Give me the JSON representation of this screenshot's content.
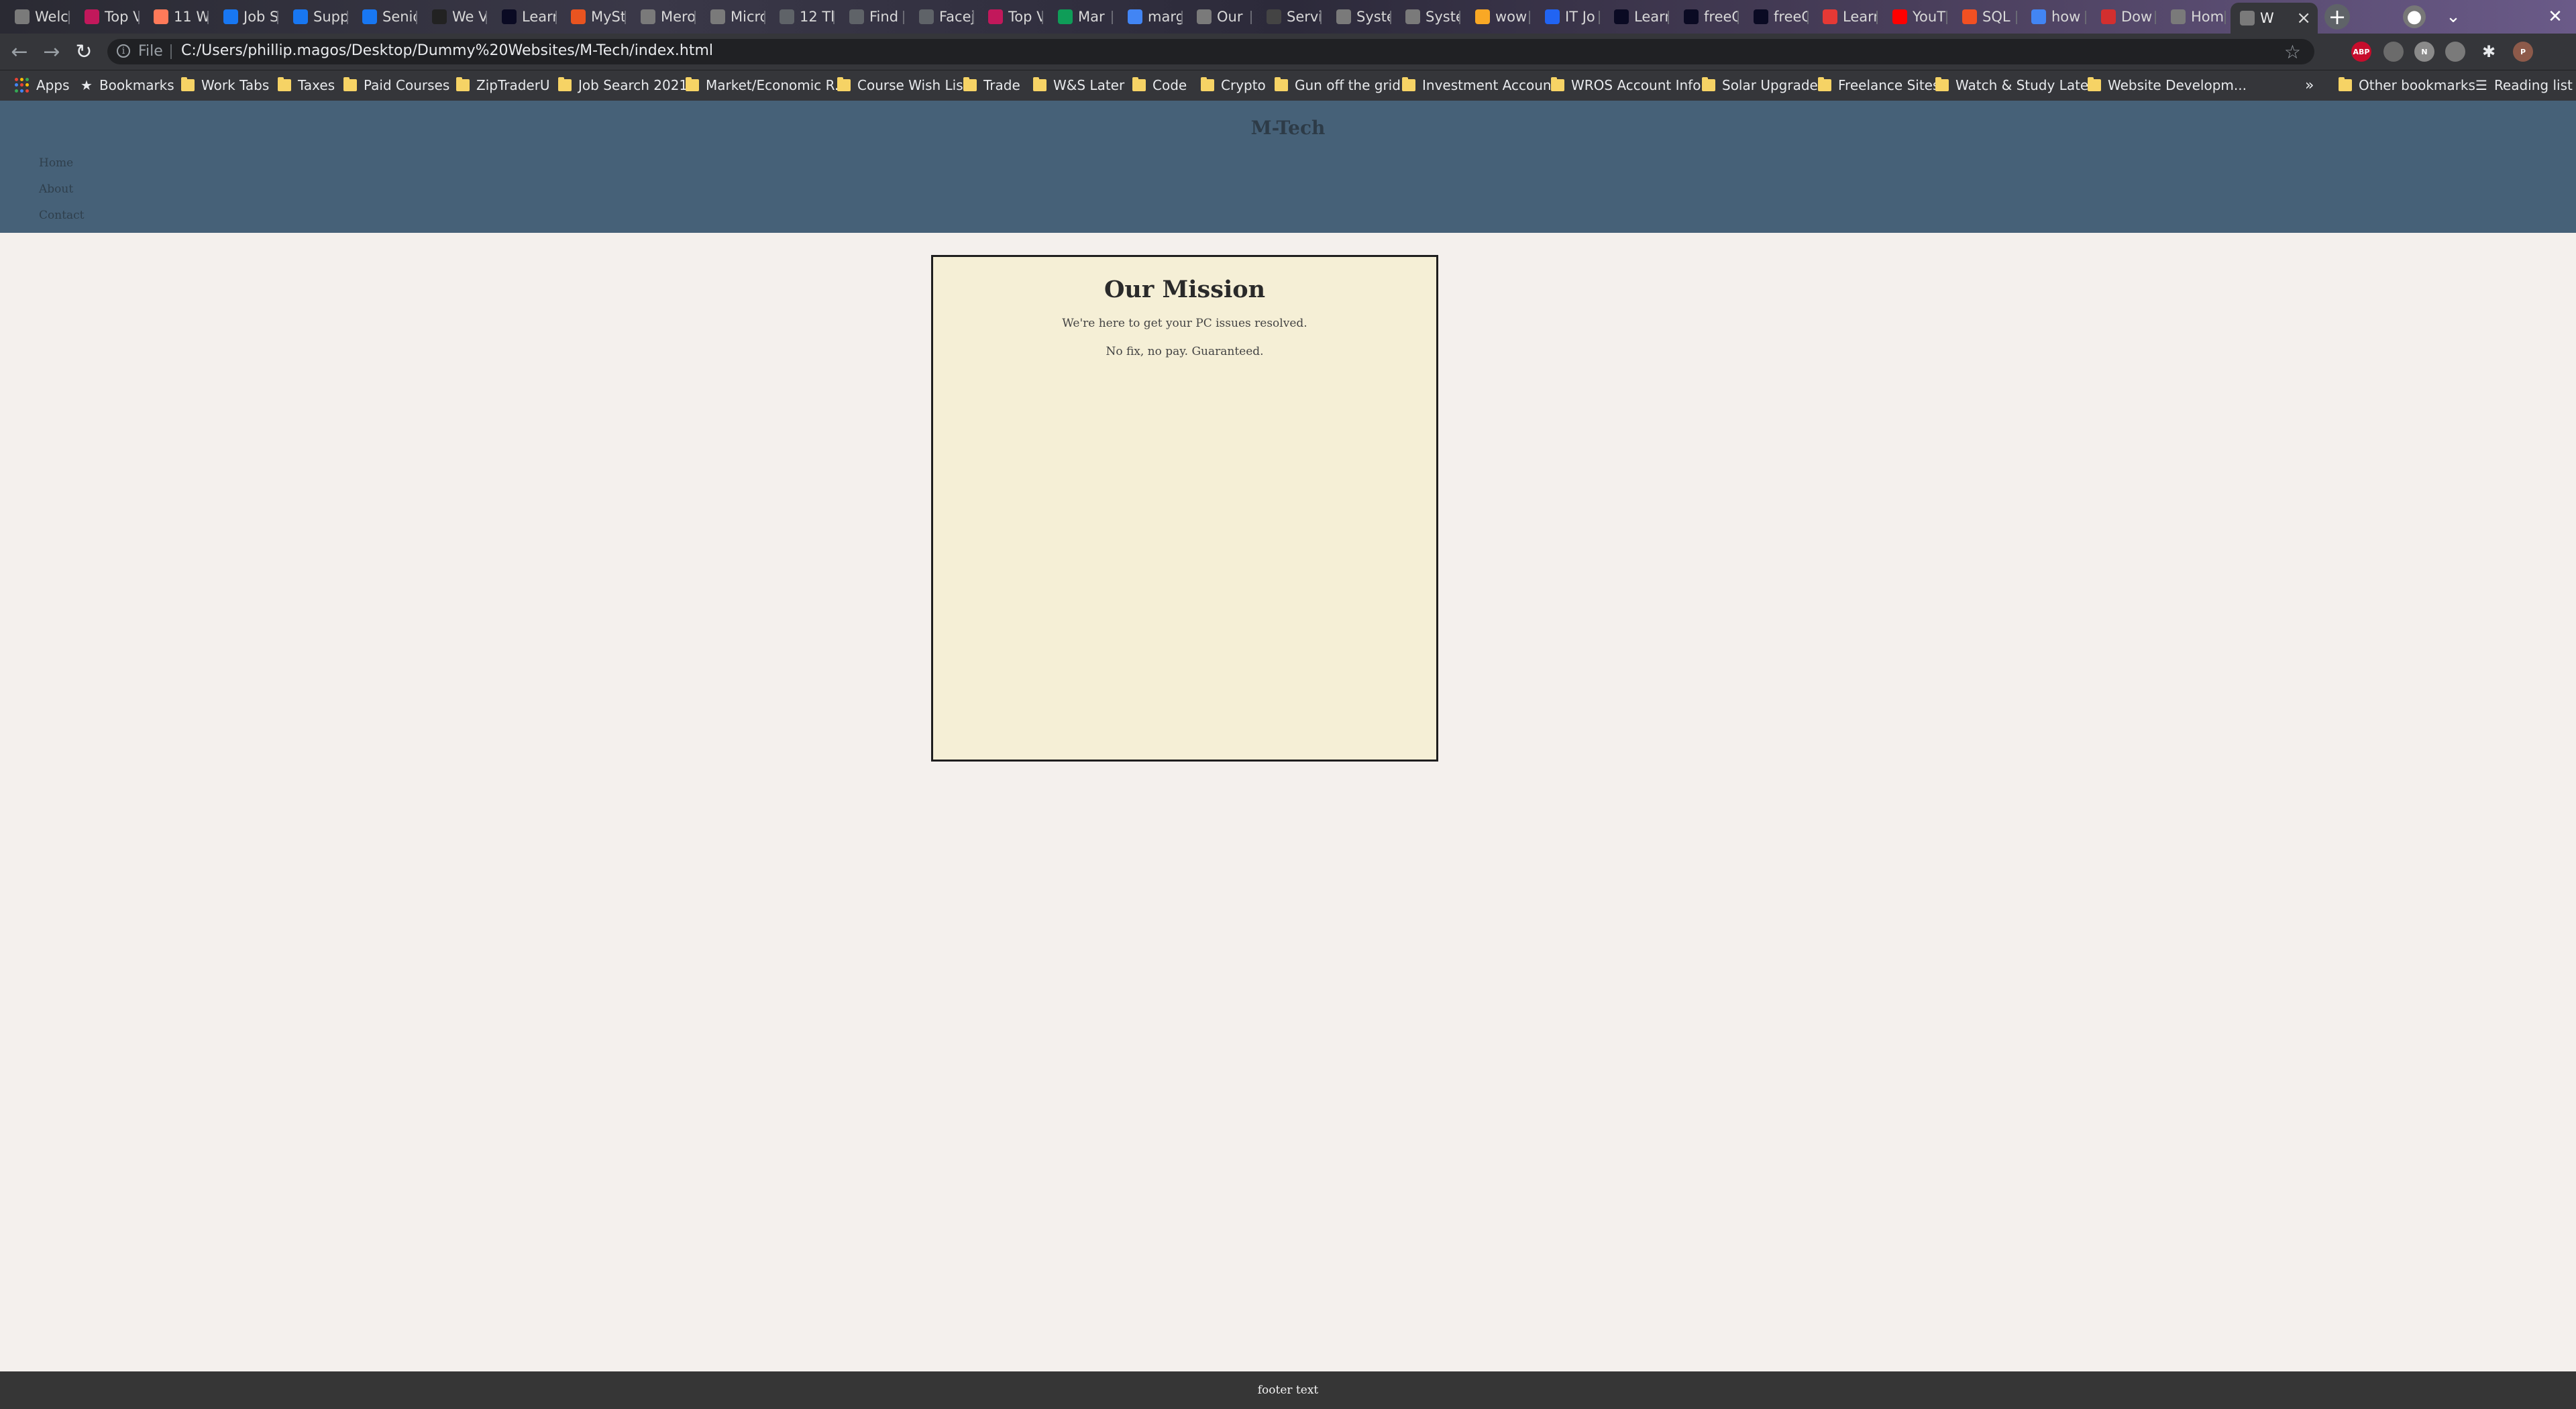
{
  "browser": {
    "tabs": [
      {
        "label": "Welc",
        "icon": "globe-icon",
        "color": "#7a7a7a"
      },
      {
        "label": "Top V",
        "icon": "adobe-xd-icon",
        "color": "#c2185b"
      },
      {
        "label": "11 W",
        "icon": "hubspot-icon",
        "color": "#ff7a59"
      },
      {
        "label": "Job S",
        "icon": "facebook-icon",
        "color": "#1877f2"
      },
      {
        "label": "Supp",
        "icon": "facebook-icon",
        "color": "#1877f2"
      },
      {
        "label": "Senio",
        "icon": "facebook-icon",
        "color": "#1877f2"
      },
      {
        "label": "We V",
        "icon": "webflow-icon",
        "color": "#222"
      },
      {
        "label": "Learn",
        "icon": "freecodecamp-icon",
        "color": "#0a0a23"
      },
      {
        "label": "MySt",
        "icon": "ubuntu-icon",
        "color": "#e95420"
      },
      {
        "label": "Mero",
        "icon": "globe-icon",
        "color": "#7a7a7a"
      },
      {
        "label": "Micro",
        "icon": "globe-icon",
        "color": "#7a7a7a"
      },
      {
        "label": "12 Th",
        "icon": "calendar-icon",
        "color": "#5f6368"
      },
      {
        "label": "Find",
        "icon": "document-icon",
        "color": "#5f6368"
      },
      {
        "label": "Facej",
        "icon": "fb-icon",
        "color": "#5f6368"
      },
      {
        "label": "Top V",
        "icon": "adobe-xd-icon",
        "color": "#c2185b"
      },
      {
        "label": "Mar",
        "icon": "sheets-icon",
        "color": "#0f9d58"
      },
      {
        "label": "marg",
        "icon": "google-icon",
        "color": "#4285f4"
      },
      {
        "label": "Our",
        "icon": "globe-icon",
        "color": "#7a7a7a"
      },
      {
        "label": "Servi",
        "icon": "mtech-icon",
        "color": "#444"
      },
      {
        "label": "Syste",
        "icon": "globe-icon",
        "color": "#7a7a7a"
      },
      {
        "label": "Syste",
        "icon": "globe-icon",
        "color": "#7a7a7a"
      },
      {
        "label": "wow",
        "icon": "emoji-icon",
        "color": "#f9a825"
      },
      {
        "label": "IT Jo",
        "icon": "indeed-icon",
        "color": "#2164f3"
      },
      {
        "label": "Learn",
        "icon": "freecodecamp-icon",
        "color": "#0a0a23"
      },
      {
        "label": "freeC",
        "icon": "freecodecamp-icon",
        "color": "#0a0a23"
      },
      {
        "label": "freeC",
        "icon": "freecodecamp-icon",
        "color": "#0a0a23"
      },
      {
        "label": "Learn",
        "icon": "gem-icon",
        "color": "#e53935"
      },
      {
        "label": "YouT",
        "icon": "youtube-icon",
        "color": "#ff0000"
      },
      {
        "label": "SQL",
        "icon": "microsoft-icon",
        "color": "#f25022"
      },
      {
        "label": "how",
        "icon": "google-icon",
        "color": "#4285f4"
      },
      {
        "label": "Dow",
        "icon": "pdf-icon",
        "color": "#d32f2f"
      },
      {
        "label": "Hom",
        "icon": "globe-icon",
        "color": "#7a7a7a"
      },
      {
        "label": "W",
        "icon": "globe-icon",
        "color": "#7a7a7a",
        "active": true
      }
    ],
    "new_tab_label": "+",
    "address": {
      "scheme_label": "File",
      "url": "C:/Users/phillip.magos/Desktop/Dummy%20Websites/M-Tech/index.html"
    },
    "extensions": [
      {
        "name": "abp-icon",
        "label": "ABP",
        "color": "#c70d2c"
      },
      {
        "name": "extension-gray-icon",
        "label": "",
        "color": "#6b6b6b"
      },
      {
        "name": "extension-n-icon",
        "label": "N",
        "color": "#8a8a8a"
      },
      {
        "name": "extension-circle-icon",
        "label": "",
        "color": "#7a7a7a"
      },
      {
        "name": "puzzle-icon",
        "label": "",
        "color": "#35363a"
      },
      {
        "name": "profile-avatar",
        "label": "P",
        "color": "#8d5a4a"
      }
    ],
    "bookmarks": [
      {
        "label": "Apps",
        "type": "apps"
      },
      {
        "label": "Bookmarks",
        "type": "star"
      },
      {
        "label": "Work Tabs",
        "type": "folder"
      },
      {
        "label": "Taxes",
        "type": "folder"
      },
      {
        "label": "Paid Courses",
        "type": "folder"
      },
      {
        "label": "ZipTraderU",
        "type": "folder"
      },
      {
        "label": "Job Search 2021",
        "type": "folder"
      },
      {
        "label": "Market/Economic R...",
        "type": "folder"
      },
      {
        "label": "Course Wish List",
        "type": "folder"
      },
      {
        "label": "Trade",
        "type": "folder"
      },
      {
        "label": "W&S Later",
        "type": "folder"
      },
      {
        "label": "Code",
        "type": "folder"
      },
      {
        "label": "Crypto",
        "type": "folder"
      },
      {
        "label": "Gun off the grid",
        "type": "folder"
      },
      {
        "label": "Investment Accounts",
        "type": "folder"
      },
      {
        "label": "WROS Account Info",
        "type": "folder"
      },
      {
        "label": "Solar Upgrade",
        "type": "folder"
      },
      {
        "label": "Freelance Sites",
        "type": "folder"
      },
      {
        "label": "Watch & Study Later",
        "type": "folder"
      },
      {
        "label": "Website Developm...",
        "type": "folder"
      }
    ],
    "bookmarks_overflow": "»",
    "other_bookmarks": "Other bookmarks",
    "reading_list": "Reading list"
  },
  "site": {
    "title": "M-Tech",
    "nav": [
      "Home",
      "About",
      "Contact"
    ],
    "header_color": "#466178",
    "mission": {
      "heading": "Our Mission",
      "lines": [
        "We're here to get your PC issues resolved.",
        "No fix, no pay. Guaranteed."
      ],
      "background": "#f5efd6"
    },
    "footer": "footer text"
  }
}
